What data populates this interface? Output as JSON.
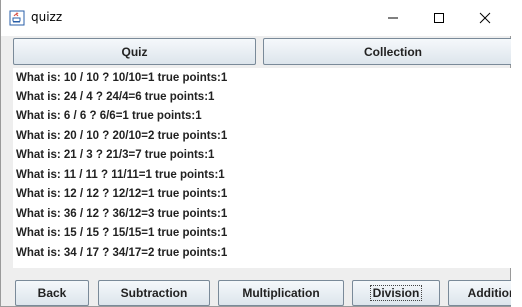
{
  "window": {
    "title": "quizz",
    "icon": "java-cup-icon",
    "controls": {
      "minimize": "—",
      "maximize": "☐",
      "close": "✕"
    }
  },
  "tabs": [
    {
      "label": "Quiz"
    },
    {
      "label": "Collection"
    }
  ],
  "results": [
    "What is: 10 / 10 ? 10/10=1 true points:1",
    "What is: 24 / 4 ? 24/4=6 true points:1",
    "What is: 6 / 6 ? 6/6=1 true points:1",
    "What is: 20 / 10 ? 20/10=2 true points:1",
    "What is: 21 / 3 ? 21/3=7 true points:1",
    "What is: 11 / 11 ? 11/11=1 true points:1",
    "What is: 12 / 12 ? 12/12=1 true points:1",
    "What is: 36 / 12 ? 36/12=3 true points:1",
    "What is: 15 / 15 ? 15/15=1 true points:1",
    "What is: 34 / 17 ? 34/17=2 true points:1"
  ],
  "buttons": {
    "back": "Back",
    "subtraction": "Subtraction",
    "multiplication": "Multiplication",
    "division": "Division",
    "addition": "Addition"
  }
}
